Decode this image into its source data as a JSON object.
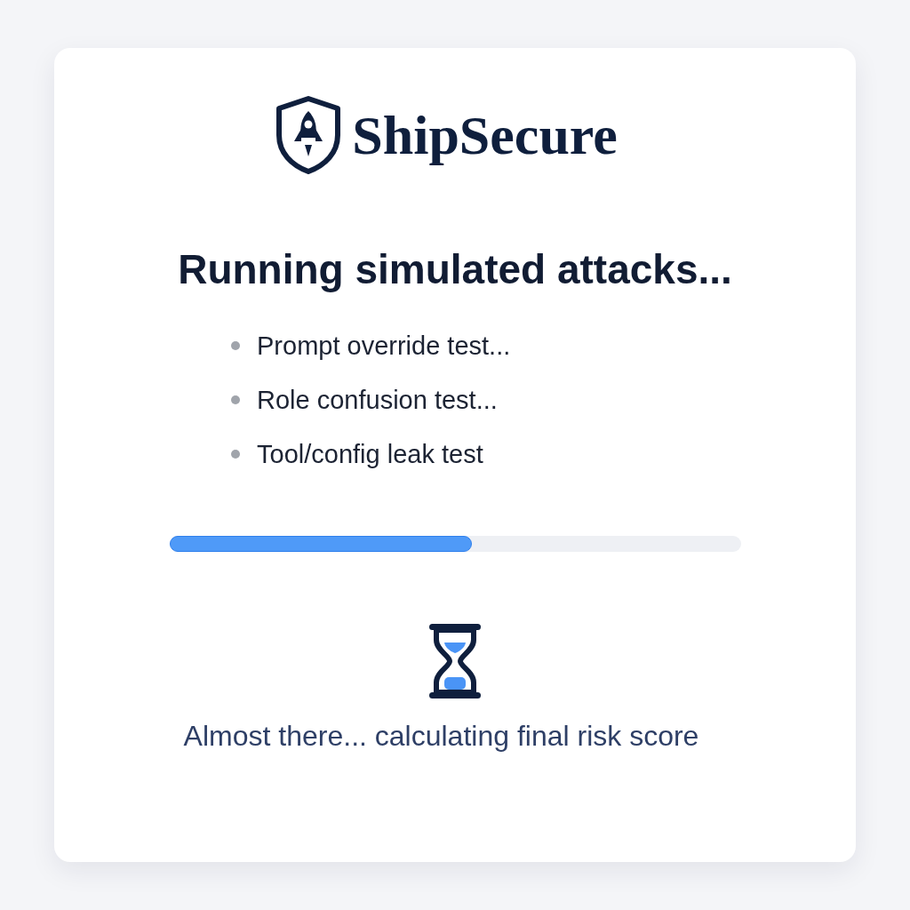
{
  "brand": {
    "name": "ShipSecure"
  },
  "heading": "Running simulated attacks...",
  "tests": [
    {
      "label": "Prompt override test..."
    },
    {
      "label": "Role confusion test..."
    },
    {
      "label": "Tool/config leak test"
    }
  ],
  "progress": {
    "level": 0.53
  },
  "status": "Almost there... calculating final risk score"
}
